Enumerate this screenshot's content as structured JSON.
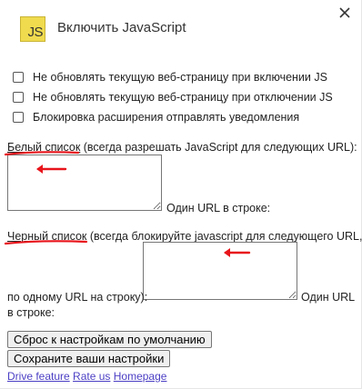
{
  "header": {
    "logo_text": "JS",
    "title": "Включить JavaScript",
    "icons": {
      "logo": "javascript-logo-icon",
      "close": "close-icon"
    }
  },
  "options": [
    {
      "label": "Не обновлять текущую веб-страницу при включении JS",
      "checked": false
    },
    {
      "label": "Не обновлять текущую веб-страницу при отключении JS",
      "checked": false
    },
    {
      "label": "Блокировка расширения отправлять уведомления",
      "checked": false
    }
  ],
  "whitelist": {
    "label_link": "Белый список",
    "label_rest": " (всегда разрешать JavaScript для следующих URL):",
    "value": "",
    "hint": "Один URL в строке:"
  },
  "blacklist": {
    "label_link": "Черный список",
    "label_rest": " (всегда блокируйте javascript для следующего URL,",
    "prefix": "по одному URL на строку):",
    "value": "",
    "hint_line1": "Один URL",
    "hint_line2": "в строке:"
  },
  "buttons": {
    "reset": "Сброс к настройкам по умолчанию",
    "save": "Сохраните ваши настройки"
  },
  "links": [
    "Drive feature",
    "Rate us",
    "Homepage"
  ],
  "colors": {
    "annotation": "#e8141b",
    "link": "#4b3fc4",
    "logo_bg": "#f0db4f"
  }
}
